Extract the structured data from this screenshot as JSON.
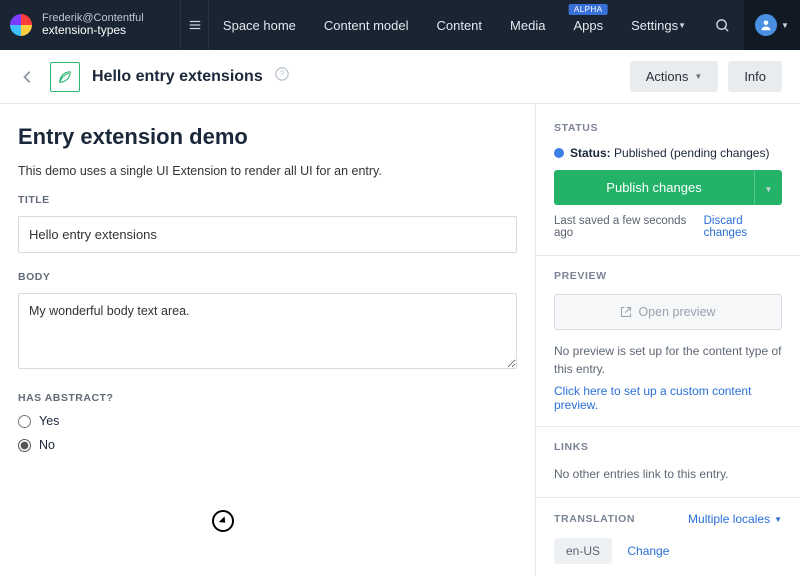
{
  "topnav": {
    "org": "Frederik@Contentful",
    "space": "extension-types",
    "items": [
      "Space home",
      "Content model",
      "Content",
      "Media",
      "Apps",
      "Settings"
    ],
    "alpha_badge": "ALPHA"
  },
  "workbench": {
    "title": "Hello entry extensions",
    "actions_label": "Actions",
    "info_label": "Info"
  },
  "main": {
    "heading": "Entry extension demo",
    "description": "This demo uses a single UI Extension to render all UI for an entry.",
    "fields": {
      "title": {
        "label": "TITLE",
        "value": "Hello entry extensions"
      },
      "body": {
        "label": "BODY",
        "value": "My wonderful body text area."
      },
      "abstract": {
        "label": "HAS ABSTRACT?",
        "options": [
          "Yes",
          "No"
        ],
        "selected": "No"
      }
    }
  },
  "sidebar": {
    "status": {
      "heading": "STATUS",
      "label": "Status:",
      "value": "Published (pending changes)",
      "publish_button": "Publish changes",
      "saved_text": "Last saved a few seconds ago",
      "discard": "Discard changes"
    },
    "preview": {
      "heading": "PREVIEW",
      "button": "Open preview",
      "empty": "No preview is set up for the content type of this entry.",
      "link": "Click here to set up a custom content preview."
    },
    "links": {
      "heading": "LINKS",
      "empty": "No other entries link to this entry."
    },
    "translation": {
      "heading": "TRANSLATION",
      "mode": "Multiple locales",
      "locale": "en-US",
      "change": "Change"
    }
  }
}
